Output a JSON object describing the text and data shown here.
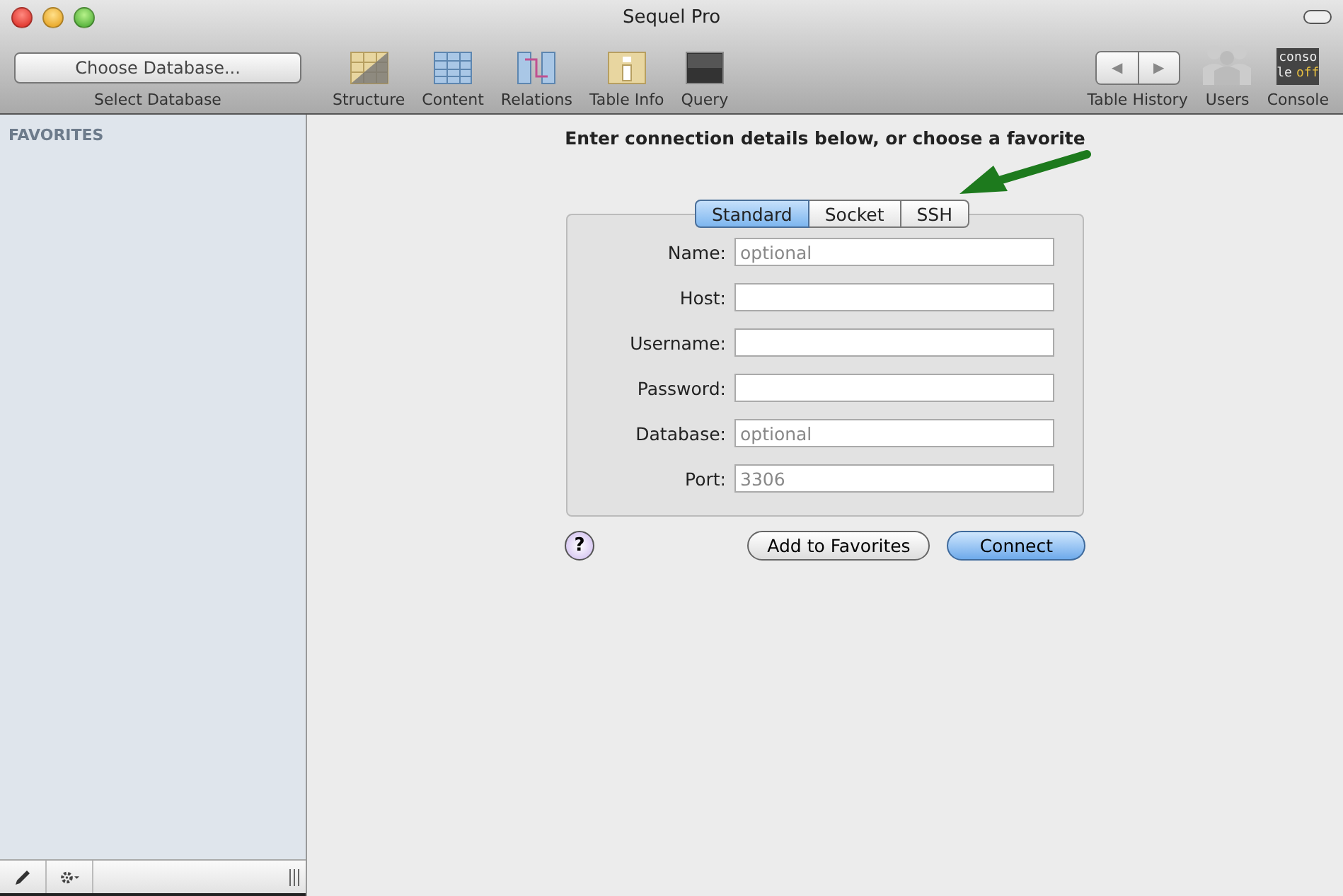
{
  "window": {
    "title": "Sequel Pro"
  },
  "toolbar": {
    "database_popup": {
      "value": "Choose Database...",
      "label": "Select Database"
    },
    "tools": [
      {
        "kind": "structure",
        "label": "Structure"
      },
      {
        "kind": "content",
        "label": "Content"
      },
      {
        "kind": "relations",
        "label": "Relations"
      },
      {
        "kind": "info",
        "label": "Table Info"
      },
      {
        "kind": "query",
        "label": "Query"
      }
    ],
    "history": {
      "back": "◀",
      "forward": "▶",
      "label": "Table History"
    },
    "users": {
      "label": "Users"
    },
    "console": {
      "icon_lines": [
        "conso",
        "le"
      ],
      "icon_state": "off",
      "label": "Console"
    }
  },
  "sidebar": {
    "heading": "FAVORITES"
  },
  "main": {
    "heading": "Enter connection details below, or choose a favorite",
    "tabs": [
      {
        "label": "Standard",
        "selected": true
      },
      {
        "label": "Socket",
        "selected": false
      },
      {
        "label": "SSH",
        "selected": false
      }
    ],
    "fields": [
      {
        "label": "Name:",
        "placeholder": "optional"
      },
      {
        "label": "Host:"
      },
      {
        "label": "Username:"
      },
      {
        "label": "Password:"
      },
      {
        "label": "Database:",
        "placeholder": "optional"
      },
      {
        "label": "Port:",
        "placeholder": "3306"
      }
    ],
    "help": "?",
    "buttons": [
      {
        "label": "Add to Favorites",
        "kind": "plain"
      },
      {
        "label": "Connect",
        "kind": "default"
      }
    ]
  }
}
